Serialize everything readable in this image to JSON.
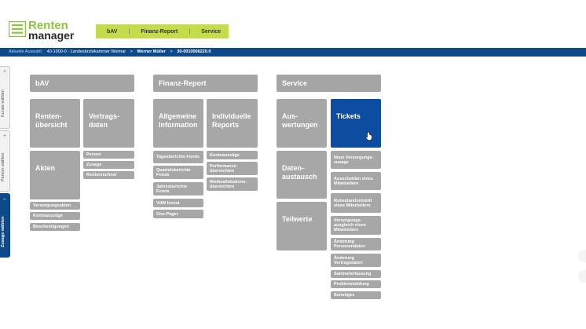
{
  "logo": {
    "line1": "Renten",
    "line2": "manager"
  },
  "topnav": {
    "items": [
      "bAV",
      "Finanz-Report",
      "Service"
    ]
  },
  "breadcrumb": {
    "label": "Aktuelle Auswahl:",
    "item1": "40-1000-0 - Landesärztekammer Weimar",
    "sep": ">",
    "item2": "Werner Müller",
    "item3": "30-0010006220.0"
  },
  "sidetabs": [
    {
      "label": "Kunde wählen",
      "symbol": "+"
    },
    {
      "label": "Person wählen",
      "symbol": "+"
    },
    {
      "label": "Zusage wählen",
      "symbol": "–"
    }
  ],
  "bav": {
    "header": "bAV",
    "tiles": [
      "Renten-\nübersicht",
      "Vertrags-\ndaten",
      "Akten"
    ],
    "vertragsdaten_items": [
      "Person",
      "Zusage",
      "Rentenrechner"
    ],
    "akten_items": [
      "Versorgungsakten",
      "Kontoauszüge",
      "Bescheinigungen"
    ]
  },
  "finanz": {
    "header": "Finanz-Report",
    "tiles": [
      "Allgemeine\nInformation",
      "Individuelle\nReports"
    ],
    "allgemein_items": [
      "Tagesberichte Fonds",
      "Quartalsberichte Fonds",
      "Jahresberichte Fonds",
      "VdW Invest",
      "One-Pager"
    ],
    "individuell_items": [
      "Kontoauszüge",
      "Performance-übersichten",
      "Risikoallokations-übersichten"
    ]
  },
  "service": {
    "header": "Service",
    "tiles": [
      "Aus-\nwertungen",
      "Tickets",
      "Daten-\naustausch",
      "Teilwerte"
    ],
    "ticket_items": [
      "Neue Versorgungs-zusage",
      "Ausscheiden eines Mitarbeiters",
      "Ruhestandseintritt eines Mitarbeiters",
      "Versorgungs-ausgleich eines Mitarbeiters",
      "Änderung Personendaten",
      "Änderung Vertragsdaten",
      "Sammelerfassung",
      "Problemmeldung",
      "Sonstiges"
    ]
  },
  "colors": {
    "tile": "#a7a7a7",
    "active": "#0d4da1",
    "nav": "#c5dc4a",
    "bar": "#0e4a8a",
    "logo_green": "#8cc63f"
  },
  "icons": {
    "logo": "rentenmanager-logo-icon",
    "cursor": "hand-pointer-icon"
  }
}
